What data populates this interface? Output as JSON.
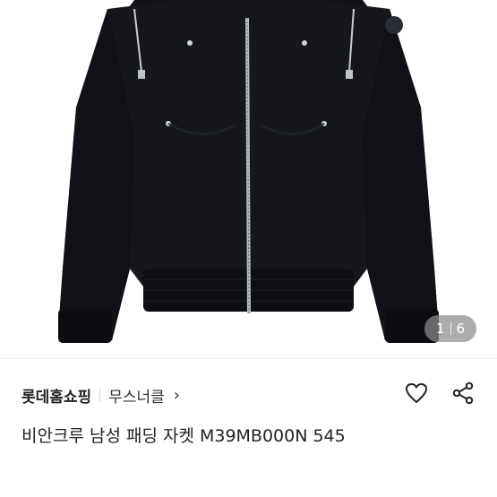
{
  "product_image": {
    "counter": {
      "current": "1",
      "total": "6"
    }
  },
  "seller": {
    "name": "롯데홈쇼핑",
    "brand": "무스너클",
    "chevron": "›"
  },
  "actions": {
    "like": "heart-icon",
    "share": "share-icon"
  },
  "product": {
    "title": "비안크루 남성 패딩 자켓 M39MB000N 545"
  },
  "colors": {
    "jacket": "#15171c",
    "counter_bg": "#8c8c8c"
  }
}
